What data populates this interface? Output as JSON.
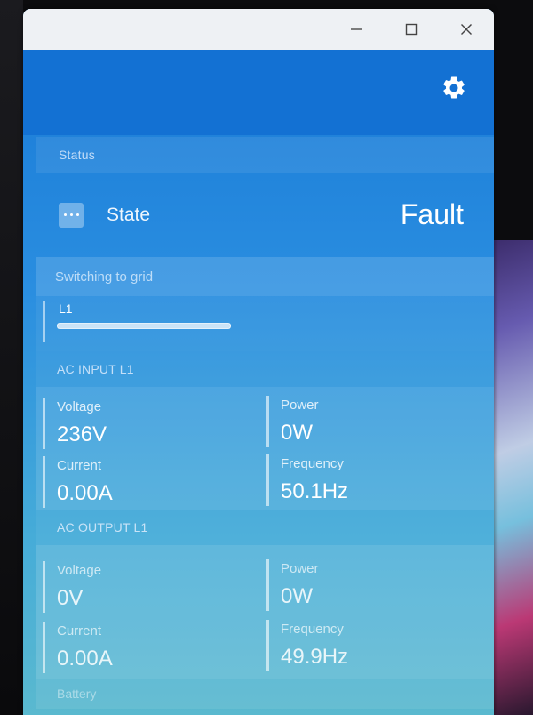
{
  "window": {
    "controls": {
      "minimize_icon": "minimize-icon",
      "maximize_icon": "maximize-icon",
      "close_icon": "close-icon"
    }
  },
  "appbar": {
    "settings_icon": "gear-icon"
  },
  "status": {
    "header": "Status",
    "state_icon": "more-icon",
    "state_label": "State",
    "state_value": "Fault"
  },
  "switching": {
    "header": "Switching to grid",
    "line_label": "L1"
  },
  "ac_input": {
    "header": "AC INPUT L1",
    "voltage_label": "Voltage",
    "voltage_value": "236V",
    "power_label": "Power",
    "power_value": "0W",
    "current_label": "Current",
    "current_value": "0.00A",
    "frequency_label": "Frequency",
    "frequency_value": "50.1Hz"
  },
  "ac_output": {
    "header": "AC OUTPUT L1",
    "voltage_label": "Voltage",
    "voltage_value": "0V",
    "power_label": "Power",
    "power_value": "0W",
    "current_label": "Current",
    "current_value": "0.00A",
    "frequency_label": "Frequency",
    "frequency_value": "49.9Hz"
  },
  "battery": {
    "header": "Battery"
  }
}
